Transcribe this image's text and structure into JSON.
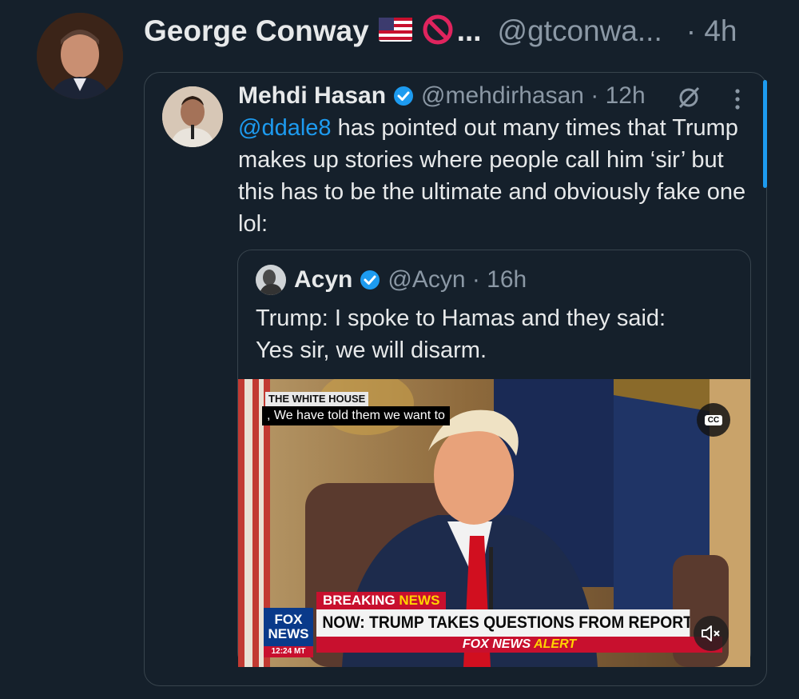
{
  "tweet": {
    "author_name": "George Conway",
    "emoji_flag": "flag-us-icon",
    "emoji_prohibited": "no-entry-sign-icon",
    "ellipsis": "...",
    "handle": "@gtconwa...",
    "time": "· 4h"
  },
  "quoted": {
    "author_name": "Mehdi Hasan",
    "handle_time": "@mehdirhasan · 12h",
    "mention": "@ddale8",
    "text": " has pointed out many times that Trump makes up stories where people call him ‘sir’ but this has to be the ultimate and obviously fake one lol:"
  },
  "nested": {
    "author_name": "Acyn",
    "handle_time": "@Acyn · 16h",
    "text_line1": "Trump: I spoke to Hamas and they said:",
    "text_line2": "Yes sir, we will disarm."
  },
  "video": {
    "tag": "THE WHITE HOUSE",
    "caption": ", We have told them we want to",
    "cc": "CC",
    "breaking_1": "BREAKING",
    "breaking_2": "NEWS",
    "headline": "NOW: TRUMP TAKES QUESTIONS FROM REPORTERS AT WH",
    "fox_logo_1": "FOX",
    "fox_logo_2": "NEWS",
    "fox_time": "12:24 MT",
    "alert_1": "FOX NEWS",
    "alert_2": "ALERT"
  },
  "colors": {
    "background": "#15202b",
    "accent": "#1d9bf0",
    "muted": "#8b98a5",
    "border": "#38444d"
  }
}
